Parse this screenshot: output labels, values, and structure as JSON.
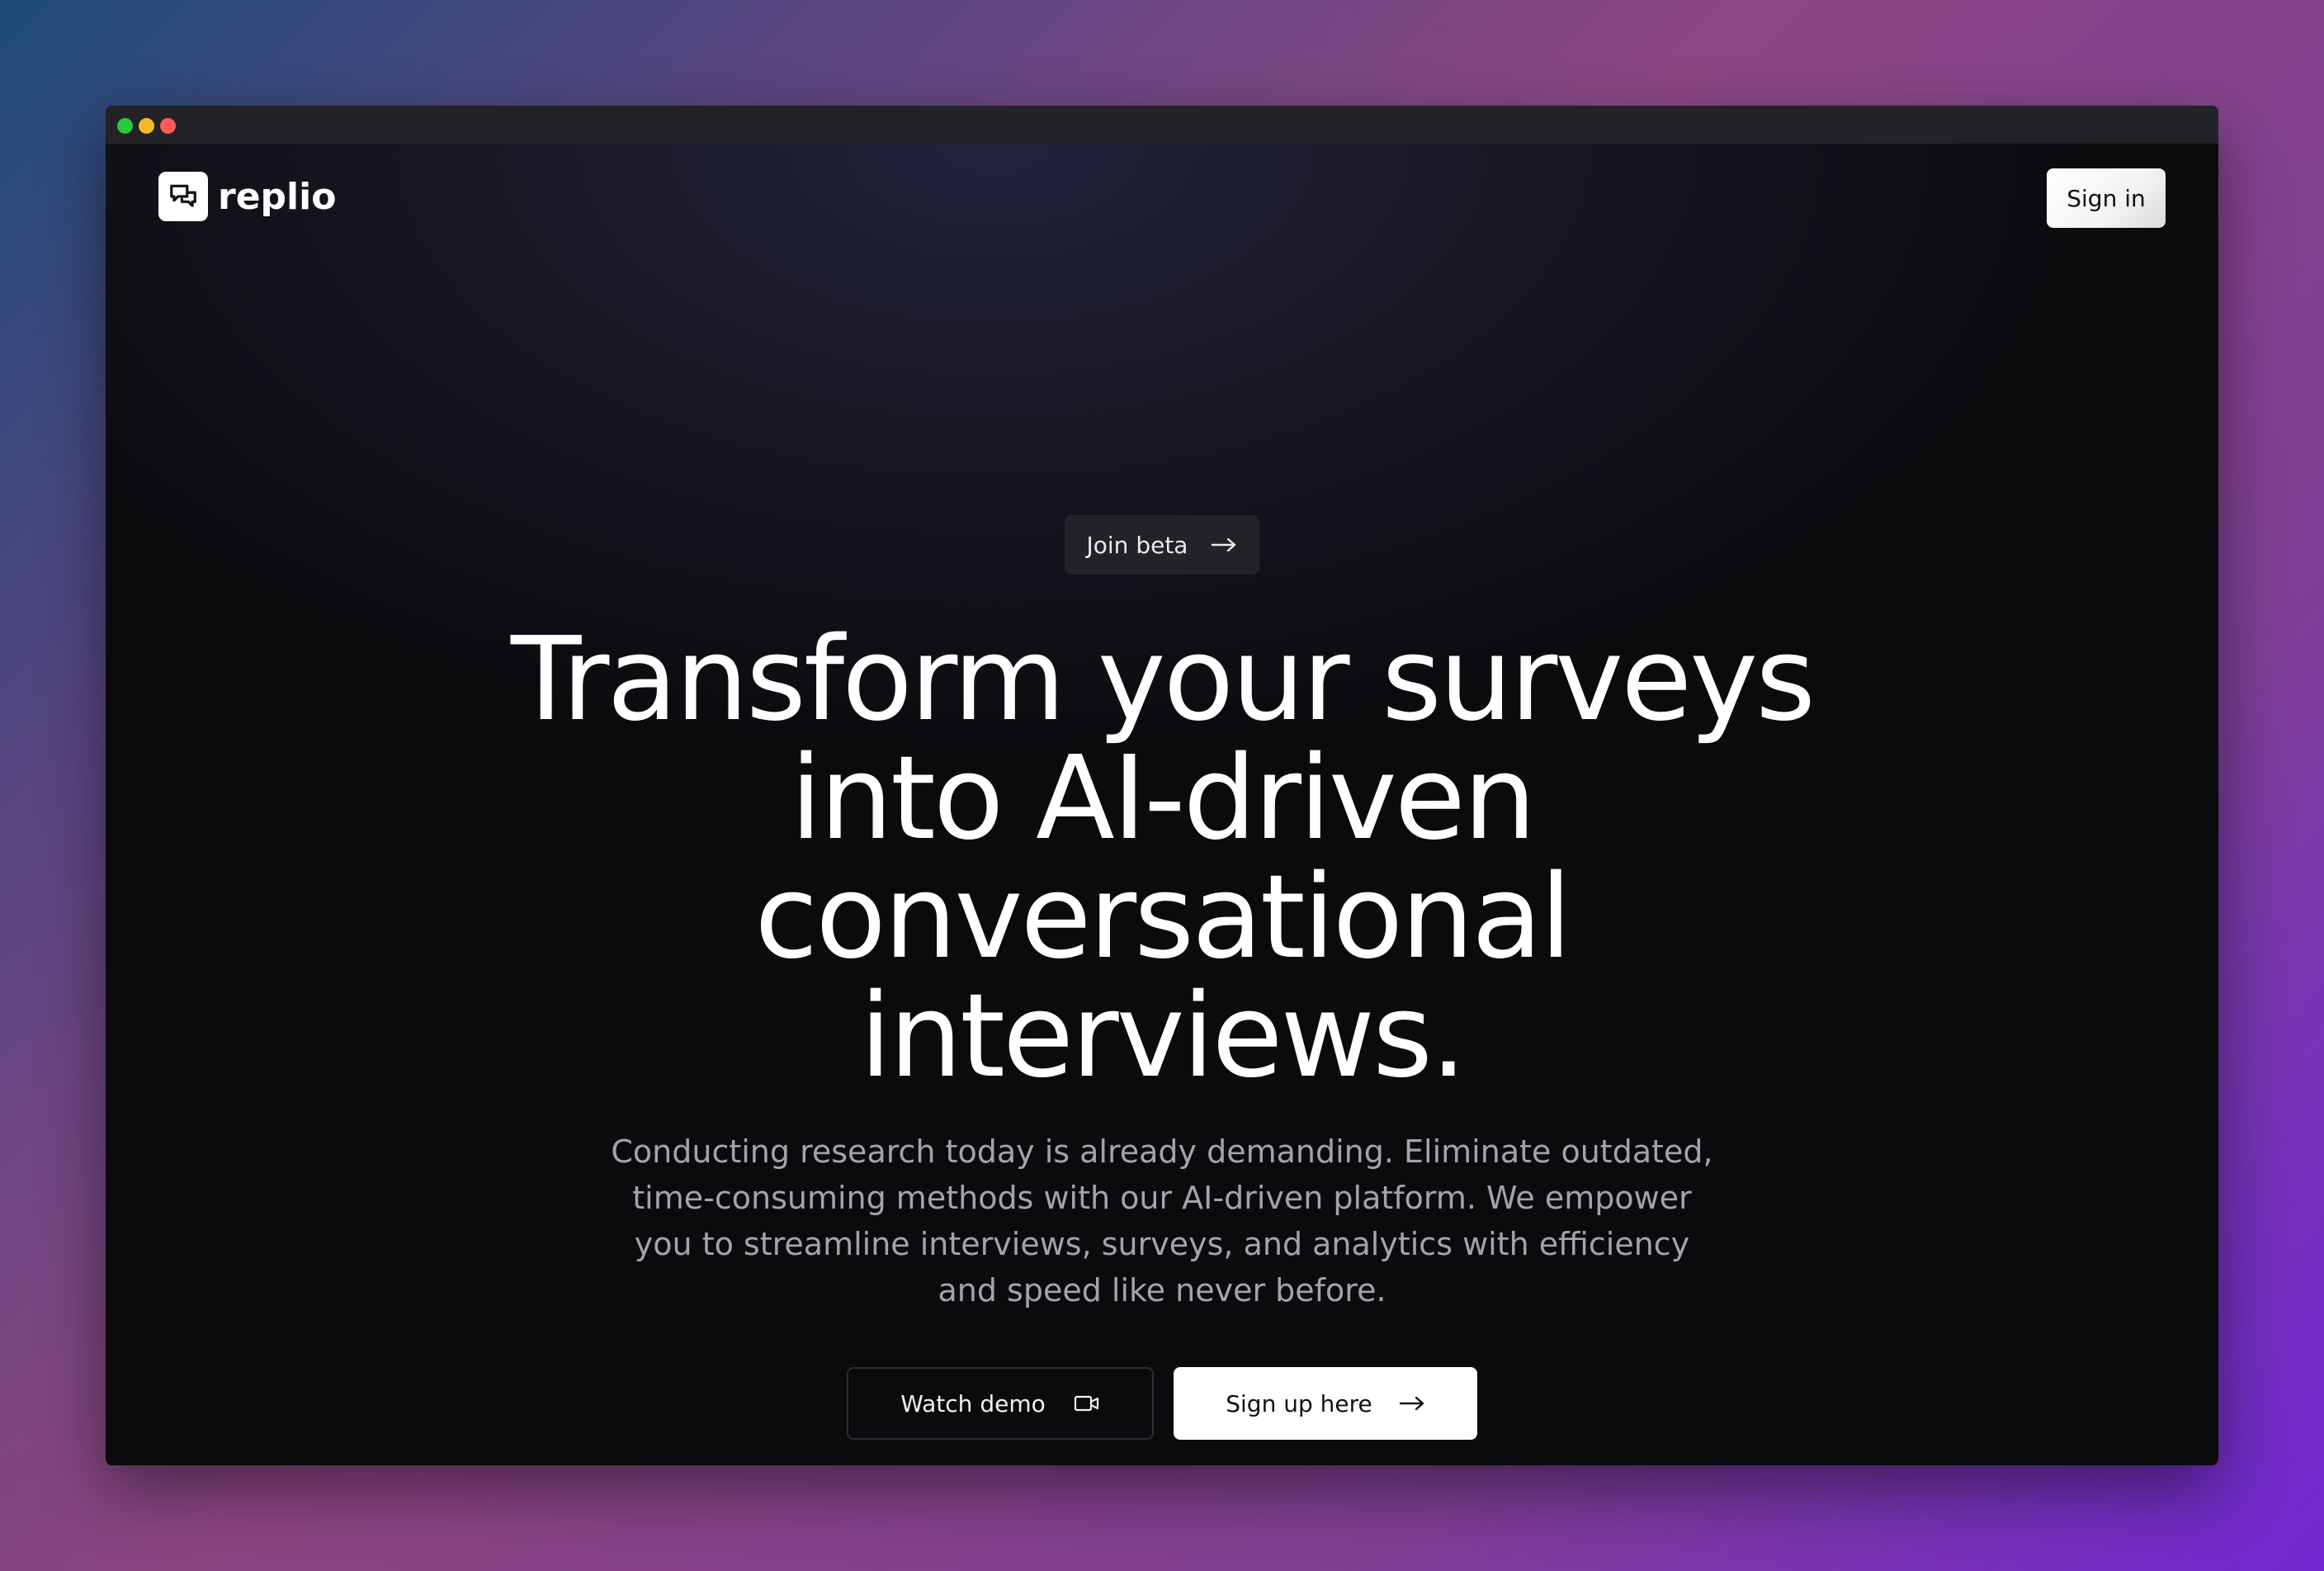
{
  "window": {
    "controls": [
      "green",
      "yellow",
      "red"
    ]
  },
  "header": {
    "logo_icon": "chat-bubbles-icon",
    "logo_text": "replio",
    "signin_label": "Sign in"
  },
  "hero": {
    "badge_label": "Join beta",
    "badge_icon": "arrow-right-icon",
    "headline_lines": [
      "Transform your surveys",
      "into AI-driven",
      "conversational",
      "interviews."
    ],
    "subtext_lines": [
      "Conducting research today is already demanding. Eliminate outdated,",
      "time-consuming methods with our AI-driven platform. We empower",
      "you to streamline interviews, surveys, and analytics with efficiency",
      "and speed like never before."
    ],
    "demo_button_label": "Watch demo",
    "demo_button_icon": "video-camera-icon",
    "signup_button_label": "Sign up here",
    "signup_button_icon": "arrow-right-icon"
  },
  "colors": {
    "window_bg": "#0b0b0e",
    "titlebar": "#232327",
    "primary_button_bg": "#ffffff",
    "subtext": "#a3a3ab"
  }
}
